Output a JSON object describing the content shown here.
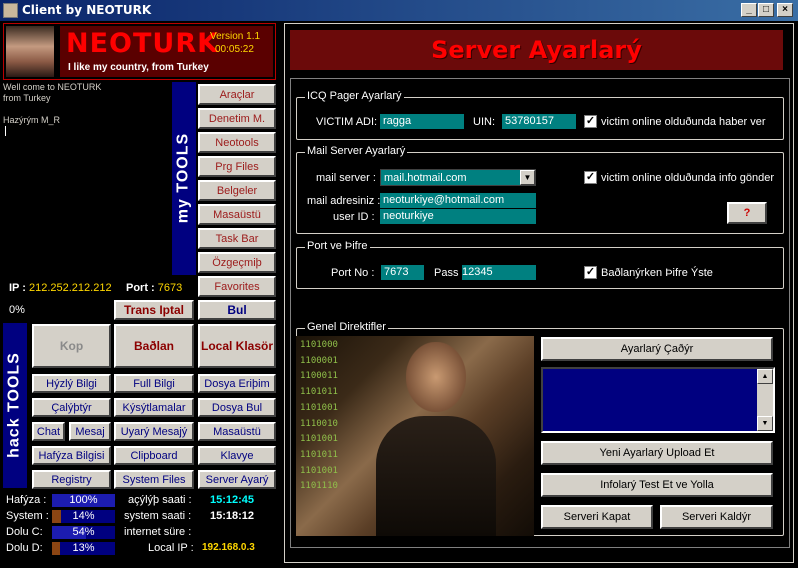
{
  "window": {
    "title": "Client by NEOTURK"
  },
  "brand": {
    "name": "NEOTURK",
    "version": "Version 1.1",
    "time": "00:05:22",
    "slogan": "I like my country, from Turkey"
  },
  "log": {
    "line1": "Well come to NEOTURK",
    "line2": "from Turkey",
    "line3": "Hazýrým M_R"
  },
  "my_tools": {
    "label": "my TOOLS",
    "items": [
      "Araçlar",
      "Denetim M.",
      "Neotools",
      "Prg Files",
      "Belgeler",
      "Masaüstü",
      "Task Bar",
      "Özgeçmiþ",
      "Favorites"
    ]
  },
  "connection": {
    "ip_label": "IP :",
    "ip": "212.252.212.212",
    "port_label": "Port :",
    "port": "7673",
    "percent": "0%",
    "trans_iptal": "Trans Iptal",
    "bul": "Bul"
  },
  "hack_tools": {
    "label": "hack TOOLS",
    "kop": "Kop",
    "baglan": "Baðlan",
    "local": "Local Klasör",
    "buttons": [
      "Hýzlý Bilgi",
      "Full Bilgi",
      "Dosya Eriþim",
      "Çalýþtýr",
      "Kýsýtlamalar",
      "Dosya Bul",
      "Chat",
      "Mesaj",
      "Uyarý Mesajý",
      "Masaüstü",
      "Hafýza Bilgisi",
      "Clipboard",
      "Klavye",
      "Registry",
      "System Files",
      "Server Ayarý"
    ]
  },
  "stats": {
    "hafiza_label": "Hafýza :",
    "hafiza": "100%",
    "hafiza_level": 1.0,
    "system_label": "System :",
    "system": "14%",
    "system_level": 0.14,
    "doluc_label": "Dolu C:",
    "doluc": "54%",
    "doluc_level": 0.54,
    "dolud_label": "Dolu D:",
    "dolud": "13%",
    "dolud_level": 0.13,
    "acilis_label": "açýlýþ saati :",
    "acilis": "15:12:45",
    "system_saati_label": "system saati :",
    "system_saati": "15:18:12",
    "internet_label": "internet süre :",
    "internet": "",
    "localip_label": "Local IP :",
    "localip": "192.168.0.3"
  },
  "server": {
    "header": "Server Ayarlarý",
    "icq": {
      "title": "ICQ Pager Ayarlarý",
      "victim_label": "VICTIM ADI:",
      "victim": "ragga",
      "uin_label": "UIN:",
      "uin": "53780157",
      "check_label": "victim online olduðunda haber ver"
    },
    "mail": {
      "title": "Mail Server Ayarlarý",
      "server_label": "mail server :",
      "server": "mail.hotmail.com",
      "address_label": "mail adresiniz :",
      "address": "neoturkiye@hotmail.com",
      "userid_label": "user ID :",
      "userid": "neoturkiye",
      "check_label": "victim online olduðunda info gönder",
      "help": "?"
    },
    "port": {
      "title": "Port ve Þifre",
      "port_label": "Port No :",
      "port": "7673",
      "pass_label": "Pass :",
      "pass": "12345",
      "check_label": "Baðlanýrken Þifre Ýste"
    },
    "genel": {
      "title": "Genel Direktifler",
      "binary": [
        "1101000",
        "1100001",
        "1100011",
        "1101011",
        "1101001",
        "1110010",
        "1101001",
        "1101011",
        "1101001",
        "1101110"
      ],
      "cagir": "Ayarlarý Çaðýr",
      "upload": "Yeni Ayarlarý Upload Et",
      "test": "Infolarý Test Et ve Yolla",
      "kapat": "Serveri Kapat",
      "kaldir": "Serveri Kaldýr"
    }
  },
  "colors": {
    "accent_red": "#ff0000",
    "header_bg": "#6b0a0a",
    "field": "#008080"
  }
}
